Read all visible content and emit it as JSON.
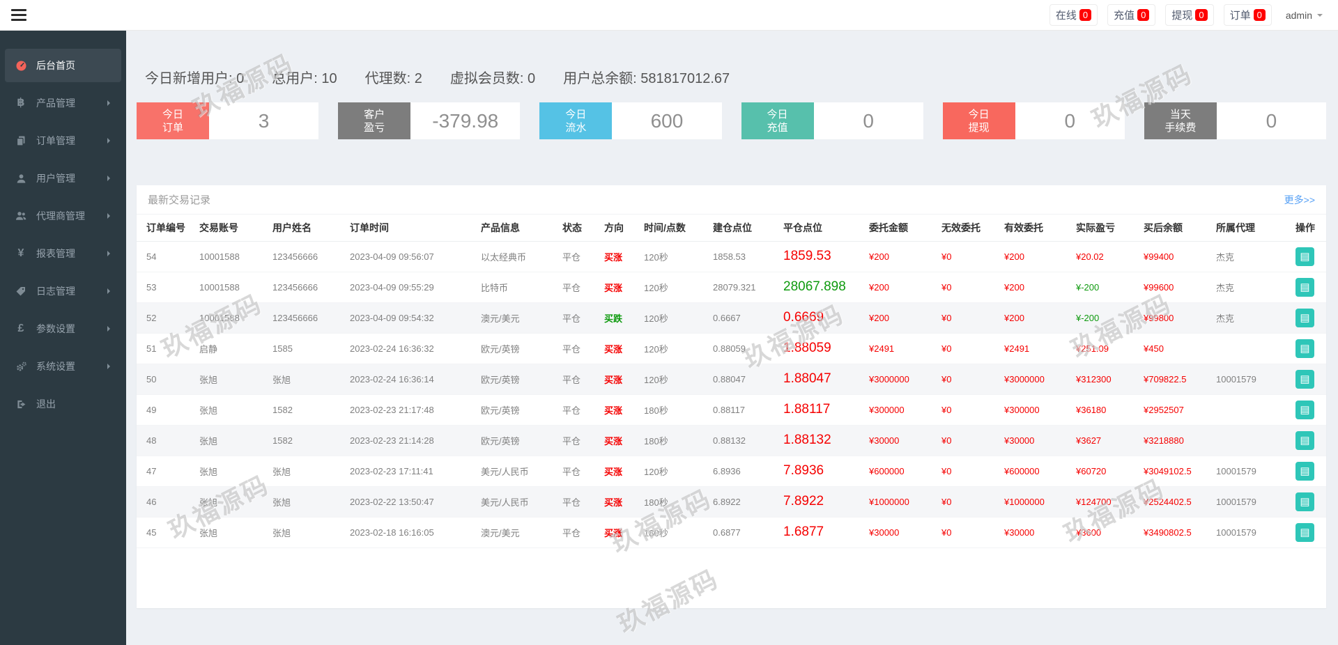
{
  "topbar": {
    "badges": [
      {
        "name": "online-badge-button",
        "label": "在线",
        "count": "0"
      },
      {
        "name": "recharge-badge-button",
        "label": "充值",
        "count": "0"
      },
      {
        "name": "withdraw-badge-button",
        "label": "提现",
        "count": "0"
      },
      {
        "name": "orders-badge-button",
        "label": "订单",
        "count": "0"
      }
    ],
    "user_name": "admin"
  },
  "sidebar": {
    "items": [
      {
        "name": "sidebar-item-home",
        "label": "后台首页",
        "icon": "dashboard-icon",
        "state_class": "active",
        "has_arrow": false
      },
      {
        "name": "sidebar-item-products",
        "label": "产品管理",
        "icon": "bitcoin-icon",
        "state_class": "",
        "has_arrow": true
      },
      {
        "name": "sidebar-item-orders",
        "label": "订单管理",
        "icon": "orders-icon",
        "state_class": "",
        "has_arrow": true
      },
      {
        "name": "sidebar-item-users",
        "label": "用户管理",
        "icon": "user-icon",
        "state_class": "",
        "has_arrow": true
      },
      {
        "name": "sidebar-item-agents",
        "label": "代理商管理",
        "icon": "agents-icon",
        "state_class": "",
        "has_arrow": true
      },
      {
        "name": "sidebar-item-reports",
        "label": "报表管理",
        "icon": "yen-icon",
        "state_class": "",
        "has_arrow": true
      },
      {
        "name": "sidebar-item-logs",
        "label": "日志管理",
        "icon": "logs-icon",
        "state_class": "",
        "has_arrow": true
      },
      {
        "name": "sidebar-item-params",
        "label": "参数设置",
        "icon": "pound-icon",
        "state_class": "",
        "has_arrow": true
      },
      {
        "name": "sidebar-item-system",
        "label": "系统设置",
        "icon": "gears-icon",
        "state_class": "",
        "has_arrow": true
      },
      {
        "name": "sidebar-item-logout",
        "label": "退出",
        "icon": "signout-icon",
        "state_class": "",
        "has_arrow": false
      }
    ]
  },
  "stats": [
    {
      "label": "今日新增用户:",
      "value": "0"
    },
    {
      "label": "总用户:",
      "value": "10"
    },
    {
      "label": "代理数:",
      "value": "2"
    },
    {
      "label": "虚拟会员数:",
      "value": "0"
    },
    {
      "label": "用户总余额:",
      "value": "581817012.67"
    }
  ],
  "cards": [
    {
      "label_line1": "今日",
      "label_line2": "订单",
      "value": "3",
      "color": "#f8726a"
    },
    {
      "label_line1": "客户",
      "label_line2": "盈亏",
      "value": "-379.98",
      "color": "#7d7d7d"
    },
    {
      "label_line1": "今日",
      "label_line2": "流水",
      "value": "600",
      "color": "#55c2e5"
    },
    {
      "label_line1": "今日",
      "label_line2": "充值",
      "value": "0",
      "color": "#57c0ac"
    },
    {
      "label_line1": "今日",
      "label_line2": "提现",
      "value": "0",
      "color": "#f8685e"
    },
    {
      "label_line1": "当天",
      "label_line2": "手续费",
      "value": "0",
      "color": "#7d7d7d"
    }
  ],
  "table": {
    "title": "最新交易记录",
    "more_label": "更多>>",
    "columns": [
      "订单编号",
      "交易账号",
      "用户姓名",
      "订单时间",
      "产品信息",
      "状态",
      "方向",
      "时间/点数",
      "建仓点位",
      "平仓点位",
      "委托金额",
      "无效委托",
      "有效委托",
      "实际盈亏",
      "买后余额",
      "所属代理",
      "操作"
    ],
    "rows": [
      {
        "id": "54",
        "account": "10001588",
        "name": "123456666",
        "time": "2023-04-09 09:56:07",
        "product": "以太经典币",
        "status": "平仓",
        "direction": "买涨",
        "direction_class": "c-red",
        "period": "120秒",
        "open": "1858.53",
        "close": "1859.53",
        "close_class": "c-red",
        "amount": "¥200",
        "invalid": "¥0",
        "valid": "¥200",
        "profit": "¥20.02",
        "profit_class": "c-red",
        "balance": "¥99400",
        "agent": "杰克"
      },
      {
        "id": "53",
        "account": "10001588",
        "name": "123456666",
        "time": "2023-04-09 09:55:29",
        "product": "比特币",
        "status": "平仓",
        "direction": "买涨",
        "direction_class": "c-red",
        "period": "120秒",
        "open": "28079.321",
        "close": "28067.898",
        "close_class": "c-green",
        "amount": "¥200",
        "invalid": "¥0",
        "valid": "¥200",
        "profit": "¥-200",
        "profit_class": "c-green",
        "balance": "¥99600",
        "agent": "杰克"
      },
      {
        "id": "52",
        "account": "10001588",
        "name": "123456666",
        "time": "2023-04-09 09:54:32",
        "product": "澳元/美元",
        "status": "平仓",
        "direction": "买跌",
        "direction_class": "c-green",
        "period": "120秒",
        "open": "0.6667",
        "close": "0.6669",
        "close_class": "c-red",
        "amount": "¥200",
        "invalid": "¥0",
        "valid": "¥200",
        "profit": "¥-200",
        "profit_class": "c-green",
        "balance": "¥99800",
        "agent": "杰克"
      },
      {
        "id": "51",
        "account": "启静",
        "name": "1585",
        "time": "2023-02-24 16:36:32",
        "product": "欧元/英镑",
        "status": "平仓",
        "direction": "买涨",
        "direction_class": "c-red",
        "period": "120秒",
        "open": "0.88059",
        "close": "1.88059",
        "close_class": "c-red",
        "amount": "¥2491",
        "invalid": "¥0",
        "valid": "¥2491",
        "profit": "¥251.09",
        "profit_class": "c-red",
        "balance": "¥450",
        "agent": ""
      },
      {
        "id": "50",
        "account": "张旭",
        "name": "张旭",
        "time": "2023-02-24 16:36:14",
        "product": "欧元/英镑",
        "status": "平仓",
        "direction": "买涨",
        "direction_class": "c-red",
        "period": "120秒",
        "open": "0.88047",
        "close": "1.88047",
        "close_class": "c-red",
        "amount": "¥3000000",
        "invalid": "¥0",
        "valid": "¥3000000",
        "profit": "¥312300",
        "profit_class": "c-red",
        "balance": "¥709822.5",
        "agent": "10001579"
      },
      {
        "id": "49",
        "account": "张旭",
        "name": "1582",
        "time": "2023-02-23 21:17:48",
        "product": "欧元/英镑",
        "status": "平仓",
        "direction": "买涨",
        "direction_class": "c-red",
        "period": "180秒",
        "open": "0.88117",
        "close": "1.88117",
        "close_class": "c-red",
        "amount": "¥300000",
        "invalid": "¥0",
        "valid": "¥300000",
        "profit": "¥36180",
        "profit_class": "c-red",
        "balance": "¥2952507",
        "agent": ""
      },
      {
        "id": "48",
        "account": "张旭",
        "name": "1582",
        "time": "2023-02-23 21:14:28",
        "product": "欧元/英镑",
        "status": "平仓",
        "direction": "买涨",
        "direction_class": "c-red",
        "period": "180秒",
        "open": "0.88132",
        "close": "1.88132",
        "close_class": "c-red",
        "amount": "¥30000",
        "invalid": "¥0",
        "valid": "¥30000",
        "profit": "¥3627",
        "profit_class": "c-red",
        "balance": "¥3218880",
        "agent": ""
      },
      {
        "id": "47",
        "account": "张旭",
        "name": "张旭",
        "time": "2023-02-23 17:11:41",
        "product": "美元/人民币",
        "status": "平仓",
        "direction": "买涨",
        "direction_class": "c-red",
        "period": "120秒",
        "open": "6.8936",
        "close": "7.8936",
        "close_class": "c-red",
        "amount": "¥600000",
        "invalid": "¥0",
        "valid": "¥600000",
        "profit": "¥60720",
        "profit_class": "c-red",
        "balance": "¥3049102.5",
        "agent": "10001579"
      },
      {
        "id": "46",
        "account": "张旭",
        "name": "张旭",
        "time": "2023-02-22 13:50:47",
        "product": "美元/人民币",
        "status": "平仓",
        "direction": "买涨",
        "direction_class": "c-red",
        "period": "180秒",
        "open": "6.8922",
        "close": "7.8922",
        "close_class": "c-red",
        "amount": "¥1000000",
        "invalid": "¥0",
        "valid": "¥1000000",
        "profit": "¥124700",
        "profit_class": "c-red",
        "balance": "¥2524402.5",
        "agent": "10001579"
      },
      {
        "id": "45",
        "account": "张旭",
        "name": "张旭",
        "time": "2023-02-18 16:16:05",
        "product": "澳元/美元",
        "status": "平仓",
        "direction": "买涨",
        "direction_class": "c-red",
        "period": "180秒",
        "open": "0.6877",
        "close": "1.6877",
        "close_class": "c-red",
        "amount": "¥30000",
        "invalid": "¥0",
        "valid": "¥30000",
        "profit": "¥3600",
        "profit_class": "c-red",
        "balance": "¥3490802.5",
        "agent": "10001579"
      }
    ]
  },
  "watermark": {
    "text": "玖福源码"
  },
  "colors": {
    "up_red": "#f50000",
    "down_green": "#0e9a0e",
    "badge_red": "#ff0000",
    "action_teal": "#2ec6b8",
    "link_blue": "#56a0f5",
    "sidebar_dark": "#2c3a42"
  }
}
